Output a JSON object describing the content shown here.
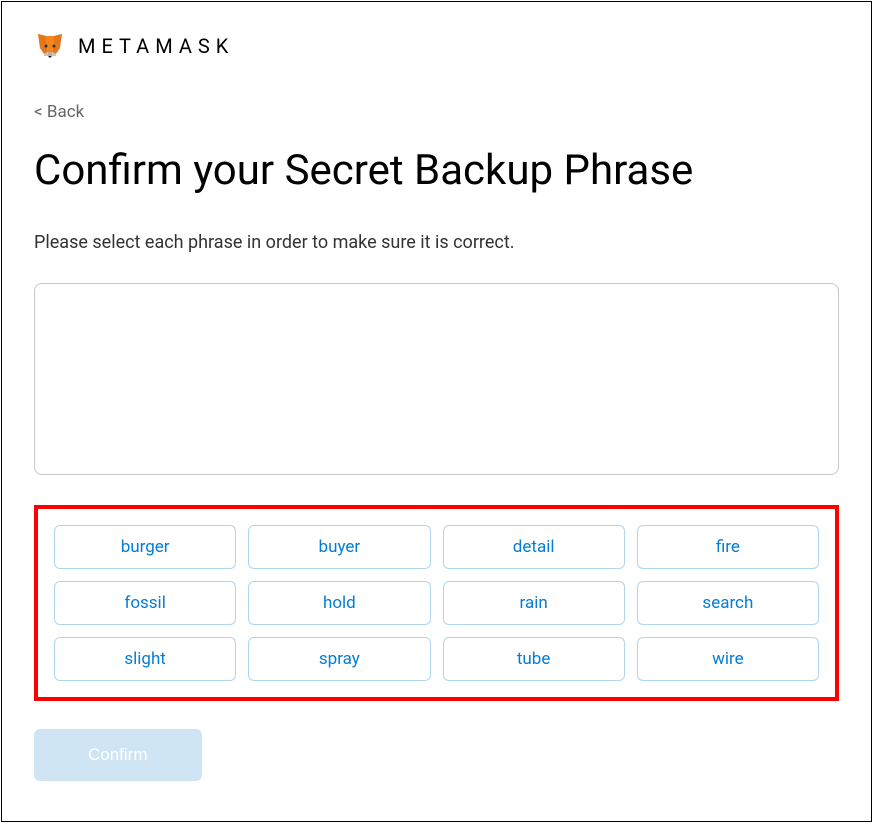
{
  "header": {
    "brand": "METAMASK"
  },
  "nav": {
    "back_label": "< Back"
  },
  "main": {
    "title": "Confirm your Secret Backup Phrase",
    "instructions": "Please select each phrase in order to make sure it is correct."
  },
  "words": [
    "burger",
    "buyer",
    "detail",
    "fire",
    "fossil",
    "hold",
    "rain",
    "search",
    "slight",
    "spray",
    "tube",
    "wire"
  ],
  "actions": {
    "confirm_label": "Confirm"
  }
}
